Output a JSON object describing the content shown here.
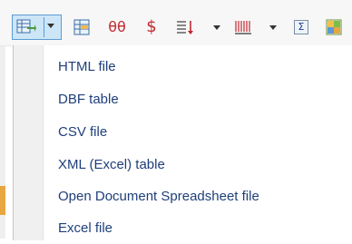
{
  "toolbar": {
    "export_button": {
      "icon": "export-table-icon"
    },
    "tools": [
      {
        "name": "table-icon"
      },
      {
        "name": "strikethrough-icon",
        "glyph": "θθ"
      },
      {
        "name": "currency-icon",
        "glyph": "$"
      },
      {
        "name": "sort-lines-icon"
      },
      {
        "name": "barcode-icon"
      },
      {
        "name": "sum-icon",
        "glyph": "Σ"
      },
      {
        "name": "grid-icon"
      }
    ],
    "accent_color": "#5b9bd5"
  },
  "menu": {
    "items": [
      {
        "label": "HTML file"
      },
      {
        "label": "DBF table"
      },
      {
        "label": "CSV file"
      },
      {
        "label": "XML (Excel) table"
      },
      {
        "label": "Open Document Spreadsheet file"
      },
      {
        "label": "Excel file"
      }
    ]
  }
}
